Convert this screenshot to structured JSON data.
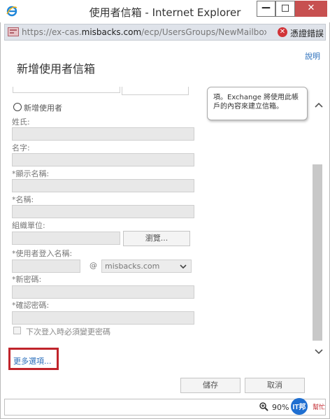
{
  "window": {
    "title": "使用者信箱 - Internet Explorer",
    "minimize": "—",
    "maximize": "□",
    "close": "✕"
  },
  "address_bar": {
    "url_prefix": "https://ex-cas.",
    "url_domain": "misbacks.com",
    "url_suffix": "/ecp/UsersGroups/NewMailboxOr",
    "cert_error": "憑證錯誤"
  },
  "page": {
    "help": "說明",
    "heading": "新增使用者信箱",
    "tooltip": "項。Exchange 將使用此帳戶的內容來建立信箱。",
    "new_user_option": "新增使用者",
    "fields": {
      "last_name": "姓氏:",
      "first_name": "名字:",
      "display_name": "*顯示名稱:",
      "name": "*名稱:",
      "ou": "組織單位:",
      "browse": "瀏覽...",
      "logon_name": "*使用者登入名稱:",
      "at": "@",
      "domain": "misbacks.com",
      "new_password": "*新密碼:",
      "confirm_password": "*確認密碼:",
      "change_pwd_next_logon": "下次登入時必須變更密碼"
    },
    "more_options": "更多選項...",
    "save": "儲存",
    "cancel": "取消"
  },
  "status_bar": {
    "zoom": "90%"
  },
  "watermark": {
    "text": "IT邦幫忙"
  },
  "colors": {
    "link": "#2a6ebb",
    "highlight_box": "#c0242b",
    "close_button": "#c75050"
  }
}
